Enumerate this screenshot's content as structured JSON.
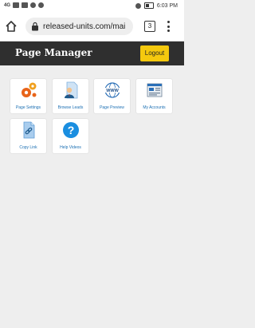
{
  "status_bar": {
    "time": "6:03 PM",
    "signal": "4G"
  },
  "browser": {
    "url": "released-units.com/mai",
    "tab_count": "3"
  },
  "header": {
    "title": "Page Manager",
    "logout_label": "Logout"
  },
  "tiles": [
    {
      "label": "Page Settings",
      "icon": "gears-icon"
    },
    {
      "label": "Browse Leads",
      "icon": "person-document-icon"
    },
    {
      "label": "Page Preview",
      "icon": "www-globe-icon"
    },
    {
      "label": "My Accounts",
      "icon": "browser-window-icon"
    },
    {
      "label": "Copy Link",
      "icon": "link-document-icon"
    },
    {
      "label": "Help Videos",
      "icon": "help-icon"
    }
  ],
  "colors": {
    "header_bg": "#2f2f2f",
    "logout_bg": "#f5c90e",
    "label_blue": "#1b6fb3"
  }
}
